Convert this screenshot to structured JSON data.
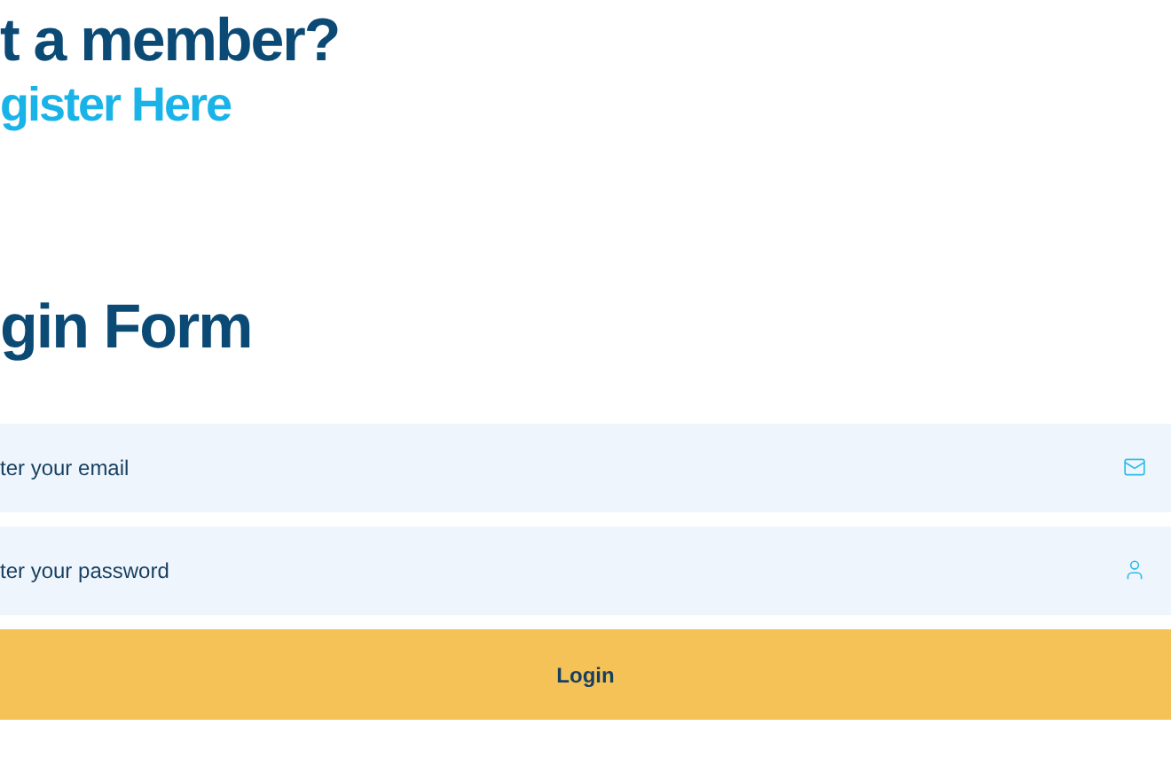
{
  "signup": {
    "question": "t a member?",
    "link": "gister Here"
  },
  "form": {
    "title": "gin Form",
    "fields": [
      {
        "kind": "email",
        "placeholder": "ter your email"
      },
      {
        "kind": "user",
        "placeholder": "ter your password"
      }
    ],
    "submit": "Login"
  }
}
